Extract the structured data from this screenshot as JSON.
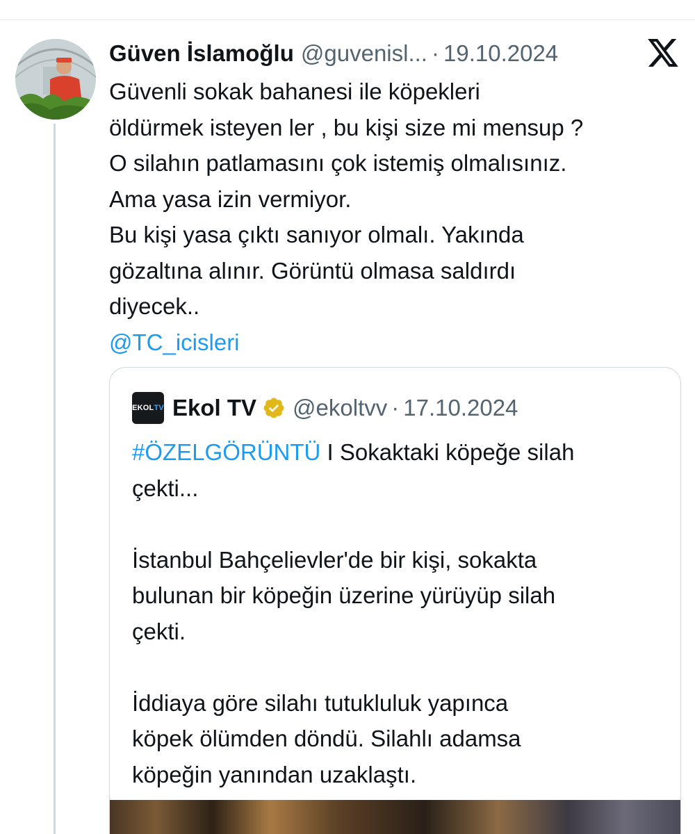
{
  "tweet": {
    "author_name": "Güven İslamoğlu",
    "author_handle": "@guvenisl...",
    "separator": "·",
    "date": "19.10.2024",
    "text_lines": [
      "Güvenli sokak bahanesi  ile  köpekleri",
      "öldürmek isteyen  ler , bu kişi size mi mensup ?",
      "O silahın patlamasını çok istemiş olmalısınız.",
      "Ama yasa izin vermiyor.",
      "Bu kişi yasa çıktı sanıyor olmalı. Yakında",
      "gözaltına alınır. Görüntü olmasa saldırdı",
      "diyecek.."
    ],
    "mention": "@TC_icisleri"
  },
  "quoted_tweet": {
    "logo_text": "EKOL",
    "logo_text_accent": "TV",
    "author_name": "Ekol TV",
    "author_handle": "@ekoltvv",
    "separator": "·",
    "date": "17.10.2024",
    "hashtag": "#ÖZELGÖRÜNTÜ",
    "first_line_rest": " I Sokaktaki köpeğe silah",
    "text_lines": [
      "çekti...",
      "",
      "İstanbul Bahçelievler'de bir kişi, sokakta",
      "bulunan bir köpeğin üzerine yürüyüp silah",
      "çekti.",
      "",
      "İddiaya göre silahı tutukluluk yapınca",
      "köpek ölümden döndü. Silahlı adamsa",
      "köpeğin yanından uzaklaştı."
    ]
  },
  "colors": {
    "link": "#1d9bf0",
    "muted": "#536471",
    "text": "#0f1419",
    "verified_badge": "#e2b719"
  },
  "icons": {
    "platform": "x-logo-icon",
    "verified": "verified-badge-icon"
  }
}
